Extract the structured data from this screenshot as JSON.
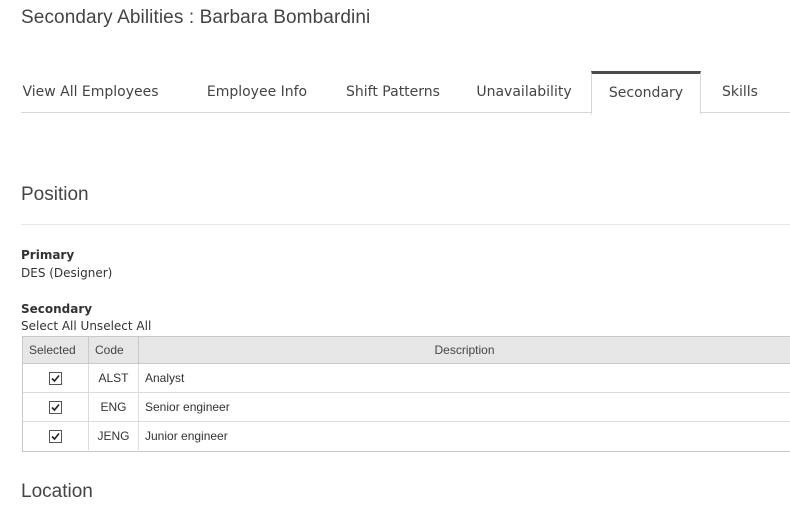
{
  "page": {
    "title": "Secondary Abilities : Barbara Bombardini"
  },
  "tabs": [
    {
      "label": "View All Employees"
    },
    {
      "label": "Employee Info"
    },
    {
      "label": "Shift Patterns"
    },
    {
      "label": "Unavailability"
    },
    {
      "label": "Secondary"
    },
    {
      "label": "Skills"
    }
  ],
  "position": {
    "title": "Position",
    "primary_label": "Primary",
    "primary_value": "DES (Designer)",
    "secondary_label": "Secondary",
    "select_all": "Select All",
    "unselect_all": "Unselect All"
  },
  "table": {
    "headers": {
      "selected": "Selected",
      "code": "Code",
      "description": "Description"
    },
    "rows": [
      {
        "selected": true,
        "code": "ALST",
        "description": "Analyst"
      },
      {
        "selected": true,
        "code": "ENG",
        "description": "Senior engineer"
      },
      {
        "selected": true,
        "code": "JENG",
        "description": "Junior engineer"
      }
    ]
  },
  "location": {
    "title": "Location"
  }
}
